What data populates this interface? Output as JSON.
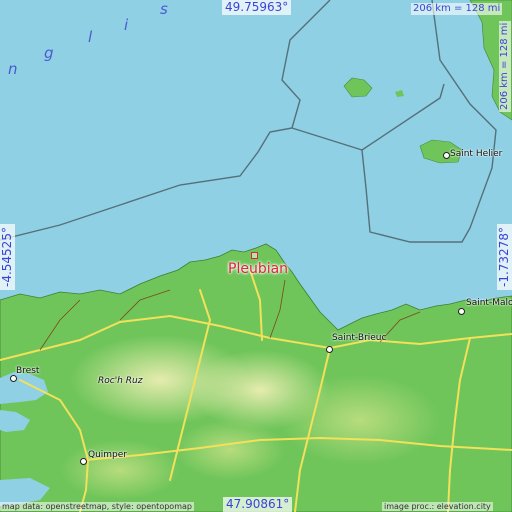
{
  "map": {
    "place": "Pleubian",
    "coords": {
      "top": "49.75963°",
      "bottom": "47.90861°",
      "left": "-4.54525°",
      "right": "-1.73278°"
    },
    "scale": {
      "horizontal": "206 km = 128 mi",
      "vertical": "206 km = 128 mi"
    },
    "sea_label_letters": [
      "n",
      "g",
      "l",
      "i",
      "s"
    ],
    "cities": [
      "Saint Helier",
      "Saint-Malo",
      "Saint-Brieuc",
      "Brest",
      "Roc'h Ruz",
      "Quimper"
    ],
    "credit_left": "map data: openstreetmap, style: opentopomap",
    "credit_right": "image proc.: elevation.city",
    "colors": {
      "sea": "#8fd0e4",
      "land": "#6fc55a",
      "highland": "#d6e6a0",
      "road": "#f2e15a",
      "place": "#e0243a",
      "coord_text": "#3b43d6"
    }
  }
}
